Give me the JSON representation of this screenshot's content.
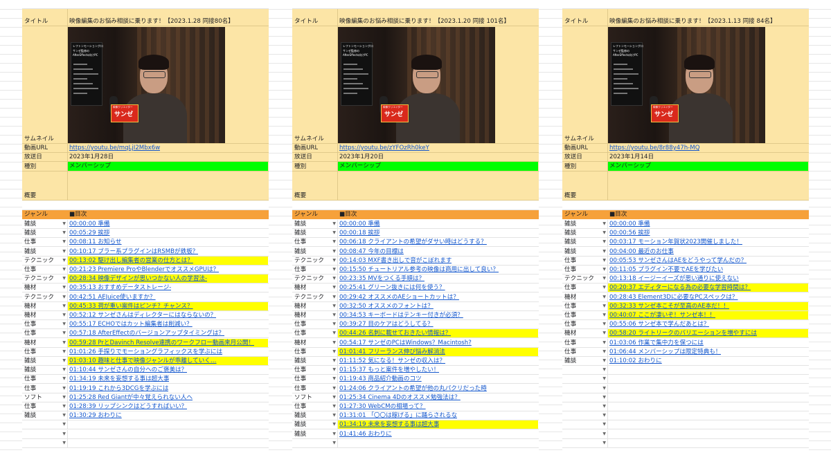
{
  "labels": {
    "title": "タイトル",
    "thumbnail": "サムネイル",
    "url": "動画URL",
    "date": "放送日",
    "kind": "種別",
    "summary": "概要",
    "genre": "ジャンル",
    "toc": "■目次"
  },
  "thumb_text": {
    "tag": "映像クリエイター",
    "name": "サンゼ",
    "banner": "レフトンモーショングロ",
    "sub1": "サンゼ監修の",
    "sub2": "AfterEffects向けPC"
  },
  "colors": {
    "yellow": "#fce5a6",
    "orange": "#f6a13a",
    "green": "#00ff00",
    "highlight": "#ffff00",
    "link": "#1155cc"
  },
  "panels": [
    {
      "title": "映像編集のお悩み相談に乗ります！【2023.1.28 同接80名】",
      "url": "https://youtu.be/mqLjI2Mbx6w",
      "date": "2023年1月28日",
      "kind": "メンバーシップ",
      "rows": [
        {
          "g": "雑談",
          "t": "00:00:00 準備",
          "h": false
        },
        {
          "g": "雑談",
          "t": "00:05:29 挨拶",
          "h": false
        },
        {
          "g": "仕事",
          "t": "00:08:11 お知らせ",
          "h": false
        },
        {
          "g": "雑談",
          "t": "00:10:17 ブラー系プラグインはRSMBが鉄板？",
          "h": false
        },
        {
          "g": "テクニック",
          "t": "00:13:02 駆け出し編集者の営業の仕方とは？",
          "h": true
        },
        {
          "g": "仕事",
          "t": "00:21:23 Premiere ProやBlenderでオススメGPUは？",
          "h": false
        },
        {
          "g": "テクニック",
          "t": "00:28:34 映像デザインが思いつかない人の学習法-",
          "h": true
        },
        {
          "g": "機材",
          "t": "00:35:13 おすすめデータストレージ-",
          "h": false
        },
        {
          "g": "テクニック",
          "t": "00:42:51 AEJuice使いますか？",
          "h": false
        },
        {
          "g": "機材",
          "t": "00:45:33 荷が重い案件はピンチ？チャンス？",
          "h": true
        },
        {
          "g": "機材",
          "t": "00:52:12 サンゼさんはディレクターにはならないの？",
          "h": false
        },
        {
          "g": "仕事",
          "t": "00:55:17 ECHOではカット編集者は削減い？",
          "h": false
        },
        {
          "g": "仕事",
          "t": "00:57:18 AfterEffectのバージョンアップタイミングは？",
          "h": false
        },
        {
          "g": "機材",
          "t": "00:59:28 PrとDavinch Resolve連携のワークフロー動画来月公開！",
          "h": true
        },
        {
          "g": "仕事",
          "t": "01:01:26 手探りでモーショングラフィックスを学ぶには",
          "h": false
        },
        {
          "g": "雑談",
          "t": "01:03:10 趣味と仕事で映像ジャンルが乖離していく…",
          "h": true
        },
        {
          "g": "雑談",
          "t": "01:10:44 サンゼさんの自分へのご褒美は？",
          "h": false
        },
        {
          "g": "仕事",
          "t": "01:34:19 未来を妄想する事は超大事",
          "h": false
        },
        {
          "g": "仕事",
          "t": "01:19:19 これから3DCGを学ぶには",
          "h": false
        },
        {
          "g": "ソフト",
          "t": "01:25:28 Red Giantが中々覚えられない人へ",
          "h": false
        },
        {
          "g": "仕事",
          "t": "01:28:39 リップシンクはどうすればいい？",
          "h": false
        },
        {
          "g": "雑談",
          "t": "01:30:29 おわりに",
          "h": false
        },
        {
          "g": "",
          "t": "",
          "h": false
        },
        {
          "g": "",
          "t": "",
          "h": false
        },
        {
          "g": "",
          "t": "",
          "h": false
        }
      ]
    },
    {
      "title": "映像編集のお悩み相談に乗ります！【2023.1.20 同接 101名】",
      "url": "https://youtu.be/zYFOzRh0keY",
      "date": "2023年1月20日",
      "kind": "メンバーシップ",
      "rows": [
        {
          "g": "雑談",
          "t": "00:00:00 準備",
          "h": false
        },
        {
          "g": "雑談",
          "t": "00:00:18 挨拶",
          "h": false
        },
        {
          "g": "仕事",
          "t": "00:06:18 クライアントの希望がダサい時はどうする？",
          "h": false
        },
        {
          "g": "雑談",
          "t": "00:08:47 今年の目標は",
          "h": false
        },
        {
          "g": "テクニック",
          "t": "00:14:03 MXF書き出しで音がこぼれます",
          "h": false
        },
        {
          "g": "仕事",
          "t": "00:15:50 チュートリアル参考の映像は商用に出して良い？",
          "h": false
        },
        {
          "g": "テクニック",
          "t": "00:23:35 MVをつくる手順は？",
          "h": false
        },
        {
          "g": "機材",
          "t": "00:25:41 グリーン抜きには何を使う？",
          "h": false
        },
        {
          "g": "テクニック",
          "t": "00:29:42 オススメのAEショートカットは？",
          "h": false
        },
        {
          "g": "機材",
          "t": "00:32:50 オススメのフォントは？",
          "h": false
        },
        {
          "g": "機材",
          "t": "00:34:53 キーボードはテンキー付きが必須？",
          "h": false
        },
        {
          "g": "仕事",
          "t": "00:39:27 目のケアはどうしてる？",
          "h": false
        },
        {
          "g": "仕事",
          "t": "00:44:26 名刺に載せておきたい情報は？",
          "h": true
        },
        {
          "g": "機材",
          "t": "00:54:17 サンゼのPCはWindows？Macintosh?",
          "h": false
        },
        {
          "g": "仕事",
          "t": "01:01:41 フリーランス伸び悩み解消法",
          "h": true
        },
        {
          "g": "雑談",
          "t": "01:11:52 気になる！サンゼの収入は？",
          "h": false
        },
        {
          "g": "仕事",
          "t": "01:15:37 もっと案件を増やしたい！",
          "h": false
        },
        {
          "g": "仕事",
          "t": "01:19:43 商品紹介動画のコツ",
          "h": false
        },
        {
          "g": "仕事",
          "t": "01:24:06 クライアントの希望が他の丸パクリだった時",
          "h": false
        },
        {
          "g": "ソフト",
          "t": "01:25:34 Cinema 4Dのオススメ勉強法は？",
          "h": false
        },
        {
          "g": "仕事",
          "t": "01:27:30 WebCMの相場って？",
          "h": false
        },
        {
          "g": "雑談",
          "t": "01:31:01 「〇〇は稼げる」に踊らされるな",
          "h": false
        },
        {
          "g": "雑談",
          "t": "01:34:19 未来を妄想する事は超大事",
          "h": true
        },
        {
          "g": "雑談",
          "t": "01:41:46 おわりに",
          "h": false
        },
        {
          "g": "",
          "t": "",
          "h": false
        }
      ]
    },
    {
      "title": "映像編集のお悩み相談に乗ります！【2023.1.13 同接 84名】",
      "url": "https://youtu.be/8r88y47h-MQ",
      "date": "2023年1月14日",
      "kind": "メンバーシップ",
      "rows": [
        {
          "g": "雑談",
          "t": "00:00:00 準備",
          "h": false
        },
        {
          "g": "雑談",
          "t": "00:00:56 挨拶",
          "h": false
        },
        {
          "g": "雑談",
          "t": "00:03:17 モーション年賀状2023開催しました！",
          "h": false
        },
        {
          "g": "雑談",
          "t": "00:04:00 最近のお仕事",
          "h": false
        },
        {
          "g": "仕事",
          "t": "00:05:53 サンゼさんはAEをどうやって学んだの？",
          "h": false
        },
        {
          "g": "仕事",
          "t": "00:11:05 プラグイン不要でAEを学びたい",
          "h": false
        },
        {
          "g": "テクニック",
          "t": "00:13:18 イージーイーズが思い通りに使えない",
          "h": false
        },
        {
          "g": "仕事",
          "t": "00:20:37 エディターになる為の必要な学習時間は？",
          "h": true
        },
        {
          "g": "機材",
          "t": "00:28:43 Element3Dに必要なPCスペックは？",
          "h": false
        },
        {
          "g": "仕事",
          "t": "00:32:33 サンゼ本こそが至高のAE本だ！！",
          "h": true
        },
        {
          "g": "仕事",
          "t": "00:40:07 ここが凄いぞ！サンゼ本！！",
          "h": true
        },
        {
          "g": "仕事",
          "t": "00:55:06 サンゼ本で学んだあとは？",
          "h": false
        },
        {
          "g": "機材",
          "t": "00:58:20 ライトリークのバリエーションを増やすには",
          "h": true
        },
        {
          "g": "仕事",
          "t": "01:03:06 作業で集中力を保つには",
          "h": false
        },
        {
          "g": "仕事",
          "t": "01:06:44 メンバーシップは限定特典も！",
          "h": false
        },
        {
          "g": "雑談",
          "t": "01:10:02 おわりに",
          "h": false
        },
        {
          "g": "",
          "t": "",
          "h": false
        },
        {
          "g": "",
          "t": "",
          "h": false
        },
        {
          "g": "",
          "t": "",
          "h": false
        },
        {
          "g": "",
          "t": "",
          "h": false
        },
        {
          "g": "",
          "t": "",
          "h": false
        },
        {
          "g": "",
          "t": "",
          "h": false
        },
        {
          "g": "",
          "t": "",
          "h": false
        },
        {
          "g": "",
          "t": "",
          "h": false
        },
        {
          "g": "",
          "t": "",
          "h": false
        }
      ]
    }
  ]
}
